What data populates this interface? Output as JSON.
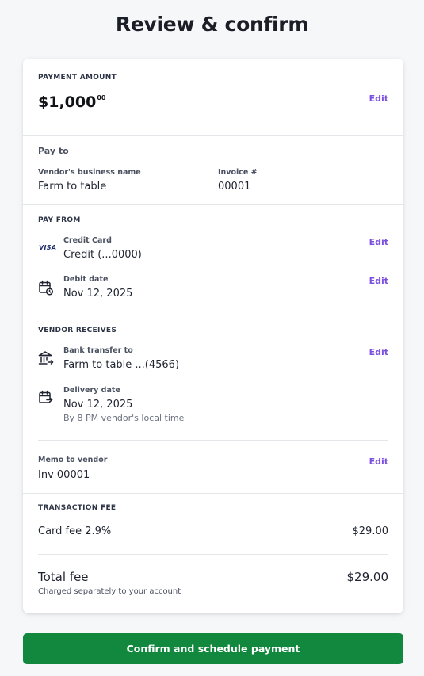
{
  "page": {
    "title": "Review & confirm"
  },
  "payment_amount": {
    "heading": "PAYMENT AMOUNT",
    "amount_main": "$1,000",
    "amount_cents": "00",
    "edit_label": "Edit"
  },
  "pay_to": {
    "heading": "Pay to",
    "vendor_label": "Vendor's business name",
    "vendor_value": "Farm to table",
    "invoice_label": "Invoice #",
    "invoice_value": "00001"
  },
  "pay_from": {
    "heading": "PAY FROM",
    "card_brand": "VISA",
    "method_label": "Credit Card",
    "method_value": "Credit (...0000)",
    "method_edit": "Edit",
    "debit_label": "Debit date",
    "debit_value": "Nov 12, 2025",
    "debit_edit": "Edit"
  },
  "vendor_receives": {
    "heading": "VENDOR RECEIVES",
    "bank_label": "Bank transfer to",
    "bank_value": "Farm to table ...(4566)",
    "bank_edit": "Edit",
    "delivery_label": "Delivery date",
    "delivery_value": "Nov 12, 2025",
    "delivery_note": "By 8 PM vendor's local time",
    "memo_label": "Memo to vendor",
    "memo_value": "Inv 00001",
    "memo_edit": "Edit"
  },
  "transaction_fee": {
    "heading": "TRANSACTION FEE",
    "card_fee_label": "Card fee 2.9%",
    "card_fee_value": "$29.00",
    "total_label": "Total fee",
    "total_value": "$29.00",
    "total_note": "Charged separately to your account"
  },
  "actions": {
    "confirm_label": "Confirm and schedule payment"
  },
  "colors": {
    "accent": "#7b4fe0",
    "primary_button": "#12873e"
  }
}
